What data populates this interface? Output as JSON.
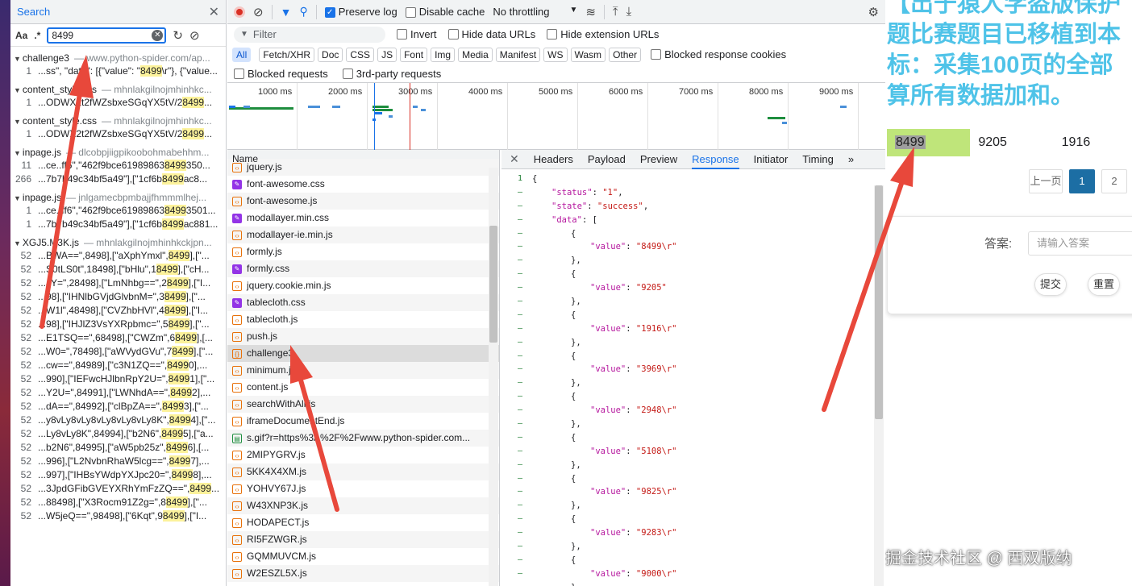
{
  "search": {
    "title": "Search",
    "opt_case": "Aa",
    "opt_regex": ".*",
    "query": "8499",
    "groups": [
      {
        "file": "challenge3",
        "path": "www.python-spider.com/ap...",
        "lines": [
          [
            "1",
            "...ss\", \"data\": [{\"value\": \"",
            "8499",
            "\\r\"}, {\"value..."
          ]
        ]
      },
      {
        "file": "content_style.css",
        "path": "mhnlakgilnojmhinhkc...",
        "lines": [
          [
            "1",
            "...ODWX2t2fWZsbxeSGqYX5tV/2",
            "8499",
            "..."
          ]
        ]
      },
      {
        "file": "content_style.css",
        "path": "mhnlakgilnojmhinhkc...",
        "lines": [
          [
            "1",
            "...ODWX2t2fWZsbxeSGqYX5tV/2",
            "8499",
            "..."
          ]
        ]
      },
      {
        "file": "inpage.js",
        "path": "dlcobpjiigpikoobohmabehhm...",
        "lines": [
          [
            "11",
            "...ce..ff6\",\"462f9bce61989863",
            "8499",
            "350..."
          ],
          [
            "266",
            "...7b7b49c34bf5a49\"],[\"1cf6b",
            "8499",
            "ac8..."
          ]
        ]
      },
      {
        "file": "inpage.js",
        "path": "jnlgamecbpmbajjfhmmmlhej...",
        "lines": [
          [
            "1",
            "...ce..ff6\",\"462f9bce61989863",
            "8499",
            "3501..."
          ],
          [
            "1",
            "...7b7b49c34bf5a49\"],[\"1cf6b",
            "8499",
            "ac881..."
          ]
        ]
      },
      {
        "file": "XGJ5.M3K.js",
        "path": "mhnlakgilnojmhinhkckjpn...",
        "lines": [
          [
            "52",
            "...BWA==\",8498],[\"aXphYmxl\",",
            "8499",
            "],[\"..."
          ],
          [
            "52",
            "...S0tLS0t\",18498],[\"bHlu\",1",
            "8499",
            "],[\"cH..."
          ],
          [
            "52",
            "...JY=\",28498],[\"LmNhbg==\",2",
            "8499",
            "],[\"I..."
          ],
          [
            "52",
            "...98],[\"IHNlbGVjdGlvbnM=\",3",
            "8499",
            "],[\"..."
          ],
          [
            "52",
            "...W1l\",48498],[\"CVZhbHVl\",4",
            "8499",
            "],[\"I..."
          ],
          [
            "52",
            "...98],[\"IHJlZ3VsYXRpbmc=\",5",
            "8499",
            "],[\"..."
          ],
          [
            "52",
            "...E1TSQ==\",68498],[\"CWZm\",6",
            "8499",
            "],[..."
          ],
          [
            "52",
            "...W0=\",78498],[\"aWVydGVu\",7",
            "8499",
            "],[\"..."
          ],
          [
            "52",
            "...cw==\",84989],[\"c3N1ZQ==\",",
            "8499",
            "0],..."
          ],
          [
            "52",
            "...990],[\"IEFwcHJlbnRpY2U=\",",
            "8499",
            "1],[\"..."
          ],
          [
            "52",
            "...Y2U=\",84991],[\"LWNhdA==\",",
            "8499",
            "2],..."
          ],
          [
            "52",
            "...dA==\",84992],[\"clBpZA==\",",
            "8499",
            "3],[\"..."
          ],
          [
            "52",
            "...y8vLy8vLy8vLy8vLy8vLy8K\",",
            "8499",
            "4],[\"..."
          ],
          [
            "52",
            "...Ly8vLy8K\",84994],[\"b2N6\",",
            "8499",
            "5],[\"a..."
          ],
          [
            "52",
            "...b2N6\",84995],[\"aW5pb25z\",",
            "8499",
            "6],[..."
          ],
          [
            "52",
            "...996],[\"L2NvbnRhaW5lcg==\",",
            "8499",
            "7],..."
          ],
          [
            "52",
            "...997],[\"IHBsYWdpYXJpc20=\",",
            "8499",
            "8],..."
          ],
          [
            "52",
            "...3JpdGFibGVEYXRhYmFzZQ==\",",
            "8499",
            "..."
          ],
          [
            "52",
            "...88498],[\"X3Rocm91Z2g=\",8",
            "8499",
            "],[\"..."
          ],
          [
            "52",
            "...W5jeQ==\",98498],[\"6Kqt\",9",
            "8499",
            "],[\"I..."
          ]
        ]
      }
    ]
  },
  "toolbar": {
    "preserve_log": "Preserve log",
    "disable_cache": "Disable cache",
    "throttling": "No throttling"
  },
  "filter": {
    "placeholder": "Filter",
    "invert": "Invert",
    "hide_data": "Hide data URLs",
    "hide_ext": "Hide extension URLs",
    "types": [
      "All",
      "Fetch/XHR",
      "Doc",
      "CSS",
      "JS",
      "Font",
      "Img",
      "Media",
      "Manifest",
      "WS",
      "Wasm",
      "Other"
    ],
    "blocked_cookies": "Blocked response cookies",
    "blocked_requests": "Blocked requests",
    "third_party": "3rd-party requests"
  },
  "timeline": {
    "ticks": [
      "1000 ms",
      "2000 ms",
      "3000 ms",
      "4000 ms",
      "5000 ms",
      "6000 ms",
      "7000 ms",
      "8000 ms",
      "9000 ms"
    ]
  },
  "requests": {
    "header": "Name",
    "items": [
      {
        "name": "jquery.js",
        "type": "js"
      },
      {
        "name": "font-awesome.css",
        "type": "css"
      },
      {
        "name": "font-awesome.js",
        "type": "js"
      },
      {
        "name": "modallayer.min.css",
        "type": "css"
      },
      {
        "name": "modallayer-ie.min.js",
        "type": "js"
      },
      {
        "name": "formly.js",
        "type": "js"
      },
      {
        "name": "formly.css",
        "type": "css"
      },
      {
        "name": "jquery.cookie.min.js",
        "type": "js"
      },
      {
        "name": "tablecloth.css",
        "type": "css"
      },
      {
        "name": "tablecloth.js",
        "type": "js"
      },
      {
        "name": "push.js",
        "type": "js"
      },
      {
        "name": "challenge3",
        "type": "xhr"
      },
      {
        "name": "minimum.js",
        "type": "js"
      },
      {
        "name": "content.js",
        "type": "js"
      },
      {
        "name": "searchWithAll.js",
        "type": "js"
      },
      {
        "name": "iframeDocumentEnd.js",
        "type": "js"
      },
      {
        "name": "s.gif?r=https%3A%2F%2Fwww.python-spider.com...",
        "type": "img"
      },
      {
        "name": "2MIPYGRV.js",
        "type": "js"
      },
      {
        "name": "5KK4X4XM.js",
        "type": "js"
      },
      {
        "name": "YOHVY67J.js",
        "type": "js"
      },
      {
        "name": "W43XNP3K.js",
        "type": "js"
      },
      {
        "name": "HODAPECT.js",
        "type": "js"
      },
      {
        "name": "RI5FZWGR.js",
        "type": "js"
      },
      {
        "name": "GQMMUVCM.js",
        "type": "js"
      },
      {
        "name": "W2ESZL5X.js",
        "type": "js"
      }
    ]
  },
  "response_tabs": [
    "Headers",
    "Payload",
    "Preview",
    "Response",
    "Initiator",
    "Timing"
  ],
  "response": {
    "status_key": "\"status\"",
    "status_val": "\"1\"",
    "state_key": "\"state\"",
    "state_val": "\"success\"",
    "data_key": "\"data\"",
    "values": [
      "\"8499\\r\"",
      "\"9205\"",
      "\"1916\\r\"",
      "\"3969\\r\"",
      "\"2948\\r\"",
      "\"5108\\r\"",
      "\"9825\\r\"",
      "\"9283\\r\"",
      "\"9000\\r\""
    ]
  },
  "webpage": {
    "banner_lines": [
      "【出于猿人学盗版保护",
      "题比赛题目已移植到本",
      "标：采集100页的全部",
      "算所有数据加和。"
    ],
    "numbers": [
      "8499",
      "9205",
      "1916"
    ],
    "prev": "上一页",
    "pages": [
      "1",
      "2"
    ],
    "answer_label": "答案:",
    "answer_placeholder": "请输入答案",
    "submit": "提交",
    "reset": "重置",
    "watermark": "掘金技术社区 @ 西双版纳"
  },
  "colors": {
    "accent": "#1a73e8",
    "highlight": "#fcf29b",
    "number_green": "#bfe57a",
    "arrow": "#e8483b",
    "banner": "#4fc3e8"
  }
}
